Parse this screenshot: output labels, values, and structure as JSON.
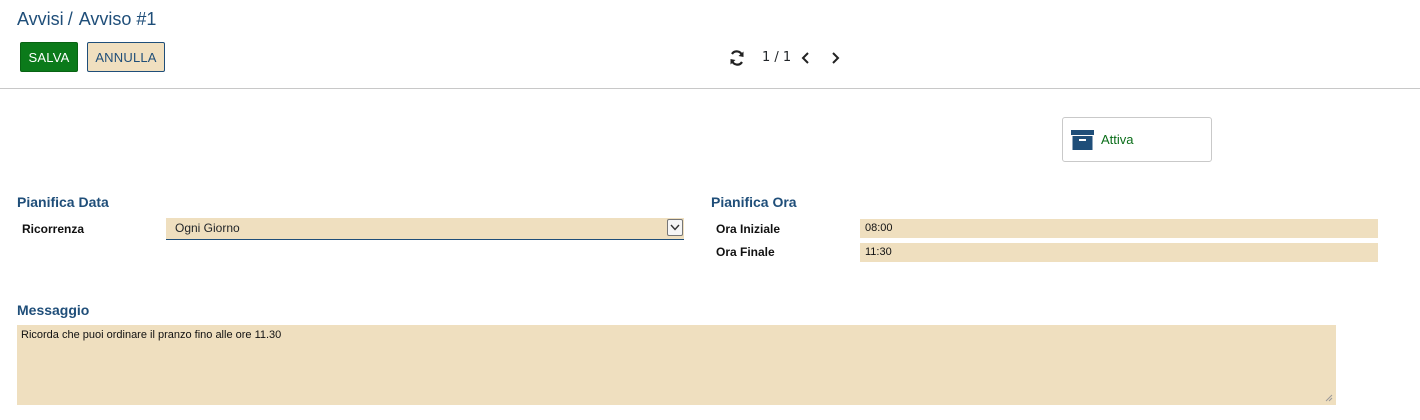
{
  "breadcrumb": {
    "parent": "Avvisi",
    "separator": "/",
    "current": "Avviso #1"
  },
  "toolbar": {
    "save_label": "SALVA",
    "cancel_label": "ANNULLA"
  },
  "pager": {
    "value": "1 / 1",
    "refresh_icon": "refresh-icon",
    "prev_icon": "chevron-left-icon",
    "next_icon": "chevron-right-icon"
  },
  "stat_button": {
    "label": "Attiva",
    "icon": "archive-icon"
  },
  "date_section": {
    "title": "Pianifica Data",
    "recurrence_label": "Ricorrenza",
    "recurrence_value": "Ogni Giorno"
  },
  "time_section": {
    "title": "Pianifica Ora",
    "start_label": "Ora Iniziale",
    "start_value": "08:00",
    "end_label": "Ora Finale",
    "end_value": "11:30"
  },
  "message_section": {
    "title": "Messaggio",
    "value": "Ricorda che puoi ordinare il pranzo fino alle ore 11.30"
  },
  "colors": {
    "primary": "#1f4e79",
    "save": "#0b7a1a",
    "field_bg": "#efdfbf",
    "active": "#0b6e1a"
  }
}
